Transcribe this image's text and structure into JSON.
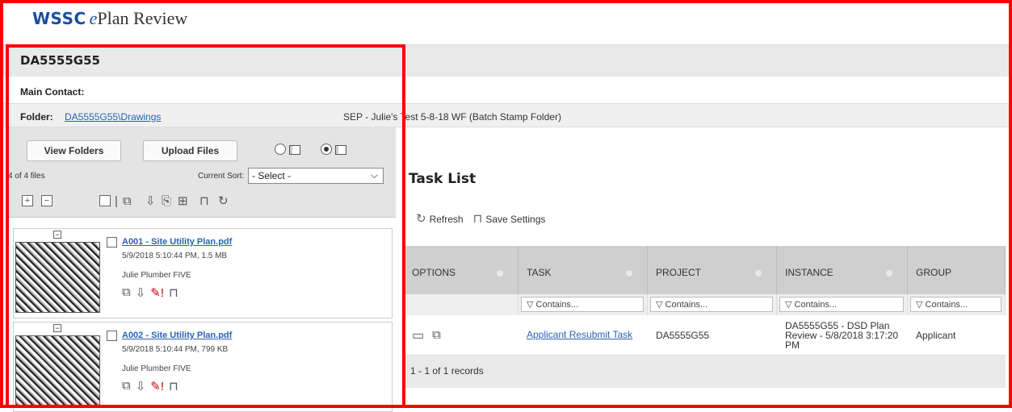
{
  "header": {
    "logo_wssc": "WSSC",
    "logo_e": "e",
    "logo_rest": "Plan Review"
  },
  "document": {
    "title": "DA5555G55",
    "main_contact_label": "Main Contact:",
    "folder_label": "Folder:",
    "folder_link": "DA5555G55\\Drawings",
    "folder_description": "SEP - Julie's Test 5-8-18 WF (Batch Stamp Folder)"
  },
  "files_panel": {
    "view_folders": "View Folders",
    "upload_files": "Upload Files",
    "count": "4 of 4 files",
    "sort_label": "Current Sort:",
    "sort_value": "- Select -",
    "files": [
      {
        "name": "A001 - Site Utility Plan.pdf",
        "meta": "5/9/2018 5:10:44 PM, 1.5 MB",
        "owner": "Julie Plumber FIVE"
      },
      {
        "name": "A002 - Site Utility Plan.pdf",
        "meta": "5/9/2018 5:10:44 PM, 799 KB",
        "owner": "Julie Plumber FIVE"
      }
    ]
  },
  "task_list": {
    "title": "Task List",
    "refresh": "Refresh",
    "save_settings": "Save Settings",
    "columns": [
      "OPTIONS",
      "TASK",
      "PROJECT",
      "INSTANCE",
      "GROUP"
    ],
    "filter_placeholder": "Contains...",
    "rows": [
      {
        "task": "Applicant Resubmit Task",
        "project": "DA5555G55",
        "instance": "DA5555G55 - DSD Plan Review - 5/8/2018 3:17:20 PM",
        "group": "Applicant"
      }
    ],
    "footer": "1 - 1 of 1 records"
  },
  "colors": {
    "brand": "#1a4fa0",
    "link": "#2a62b5",
    "highlight": "#ff0000"
  },
  "icons": [
    "refresh-icon",
    "lock-icon",
    "comment-icon",
    "history-icon",
    "filter-icon"
  ]
}
